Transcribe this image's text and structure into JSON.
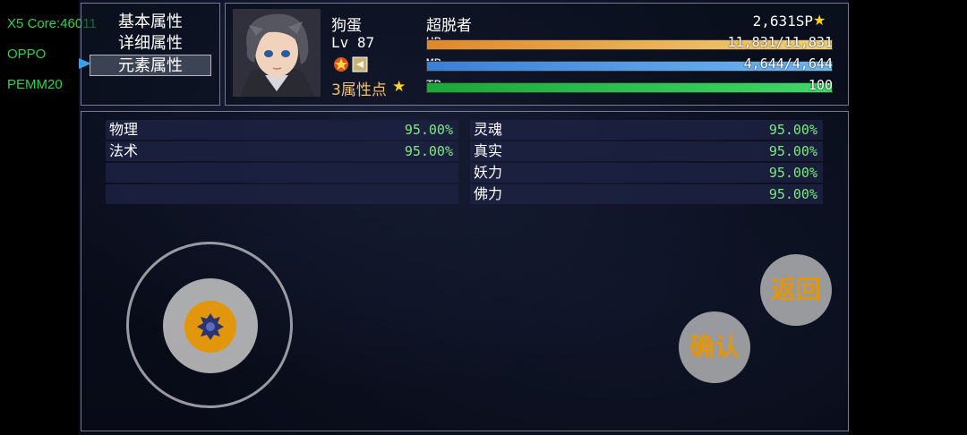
{
  "debug": [
    "X5 Core:46011",
    "OPPO",
    "PEMM20"
  ],
  "menu": {
    "items": [
      "基本属性",
      "详细属性",
      "元素属性"
    ],
    "selected_index": 2
  },
  "actor": {
    "name": "狗蛋",
    "class": "超脱者",
    "level": "Lv 87",
    "points": "3属性点",
    "sp": "2,631SP",
    "hp_label": "HP",
    "hp": "11,831/11,831",
    "mp_label": "MP",
    "mp": "4,644/4,644",
    "tp_label": "TP",
    "tp": "100",
    "hp_ratio": 1.0,
    "mp_ratio": 1.0,
    "tp_ratio": 1.0
  },
  "elements_left": [
    {
      "name": "物理",
      "value": "95.00%"
    },
    {
      "name": "法术",
      "value": "95.00%"
    },
    {
      "name": "",
      "value": ""
    },
    {
      "name": "",
      "value": ""
    }
  ],
  "elements_right": [
    {
      "name": "灵魂",
      "value": "95.00%"
    },
    {
      "name": "真实",
      "value": "95.00%"
    },
    {
      "name": "妖力",
      "value": "95.00%"
    },
    {
      "name": "佛力",
      "value": "95.00%"
    }
  ],
  "buttons": {
    "back": "返回",
    "confirm": "确认"
  },
  "colors": {
    "hp_gradient": [
      "#e0872a",
      "#f2d27a"
    ],
    "mp_gradient": [
      "#3a7fd8",
      "#6fb8f2"
    ],
    "tp_gradient": [
      "#1aa838",
      "#3ed868"
    ],
    "value_text": "#7fe87f",
    "accent_orange": "#e2960c"
  }
}
